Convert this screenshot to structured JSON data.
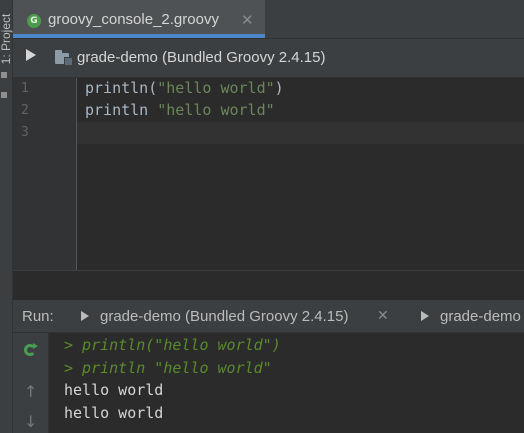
{
  "left_strip": {
    "project_label": "1: Project"
  },
  "tab_bar": {
    "tab": {
      "icon_letter": "G",
      "title": "groovy_console_2.groovy",
      "close": "✕"
    }
  },
  "toolbar": {
    "module_label": "grade-demo (Bundled Groovy 2.4.15)"
  },
  "editor": {
    "line_numbers": [
      "1",
      "2",
      "3"
    ],
    "lines": [
      {
        "code": "println(",
        "string": "\"hello world\"",
        "tail": ")"
      },
      {
        "code": "println ",
        "string": "\"hello world\"",
        "tail": ""
      }
    ]
  },
  "run_panel": {
    "title": "Run:",
    "tabs": [
      {
        "label": "grade-demo (Bundled Groovy 2.4.15)",
        "close": "✕"
      },
      {
        "label": "grade-demo"
      }
    ],
    "side_icons": {
      "up": "↑",
      "down": "↓"
    },
    "console": [
      {
        "text": "> println(\"hello world\")",
        "kind": "echo"
      },
      {
        "text": "> println \"hello world\"",
        "kind": "echo"
      },
      {
        "text": "hello world",
        "kind": "out"
      },
      {
        "text": "hello world",
        "kind": "out"
      }
    ]
  },
  "colors": {
    "background": "#2b2b2b",
    "panel": "#3c3f41",
    "accent": "#4a88c7",
    "string": "#6a8759",
    "echo": "#5a8a2c",
    "groovy_icon": "#4c9b4b"
  }
}
